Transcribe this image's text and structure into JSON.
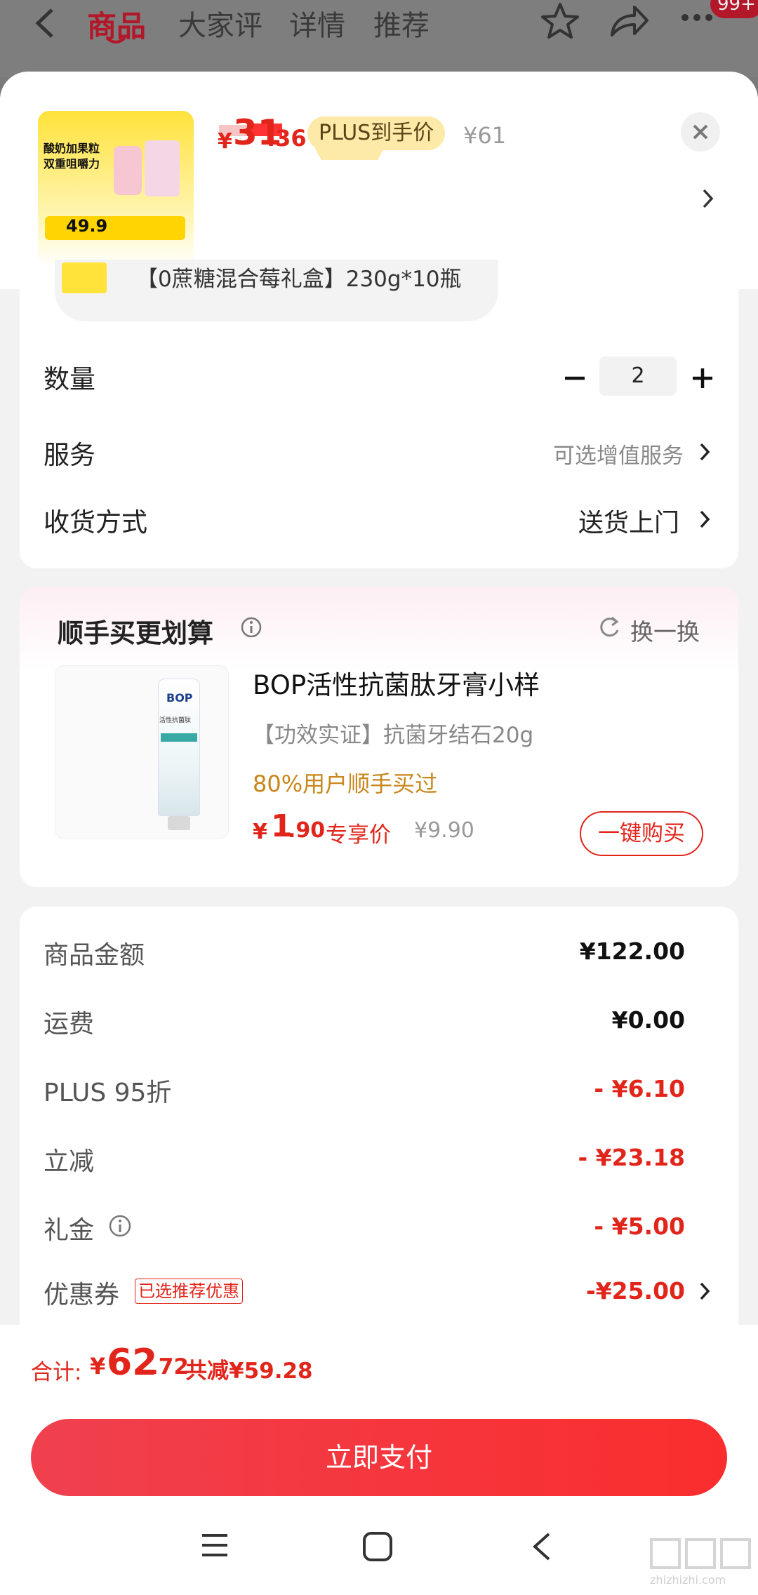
{
  "topnav": {
    "tabs": [
      "商品",
      "大家评",
      "详情",
      "推荐"
    ],
    "badge": "99+"
  },
  "product": {
    "image": {
      "headline1": "酸奶加果粒",
      "headline2": "双重咀嚼力",
      "price": "49.9"
    },
    "currency": "¥",
    "price_int": "31",
    "price_dec": ".36",
    "plus_label": "PLUS到手价",
    "orig_price": "¥61",
    "variant_text": "【0蔗糖混合莓礼盒】230g*10瓶"
  },
  "options": {
    "qty_label": "数量",
    "qty_value": "2",
    "service_label": "服务",
    "service_value": "可选增值服务",
    "delivery_label": "收货方式",
    "delivery_value": "送货上门"
  },
  "addon": {
    "title": "顺手买更划算",
    "refresh": "换一换",
    "name": "BOP活性抗菌肽牙膏小样",
    "desc": "【功效实证】抗菌牙结石20g",
    "social": "80%用户顺手买过",
    "price_cur": "¥",
    "price_int": "1",
    "price_dec": ".90",
    "price_tag": "专享价",
    "orig": "¥9.90",
    "buy": "一键购买",
    "pack_brand": "BOP",
    "pack_name": "活性抗菌肽"
  },
  "summary": {
    "rows": [
      {
        "label": "商品金额",
        "amount": "¥122.00"
      },
      {
        "label": "运费",
        "amount": "¥0.00"
      },
      {
        "label": "PLUS 95折",
        "amount": "- ¥6.10"
      },
      {
        "label": "立减",
        "amount": "- ¥23.18"
      },
      {
        "label": "礼金",
        "amount": "- ¥5.00"
      },
      {
        "label": "优惠券",
        "amount": "-¥25.00"
      }
    ],
    "coupon_tag": "已选推荐优惠"
  },
  "footer": {
    "total_label": "合计:",
    "total_cur": "¥",
    "total_int": "62",
    "total_dec": ".72",
    "saved": "共减¥59.28",
    "pay_button": "立即支付"
  },
  "watermark": "zhizhizhi.com",
  "colors": {
    "accent": "#e1251b",
    "gold": "#c9861a",
    "plus_bg": "#fde9a8"
  }
}
